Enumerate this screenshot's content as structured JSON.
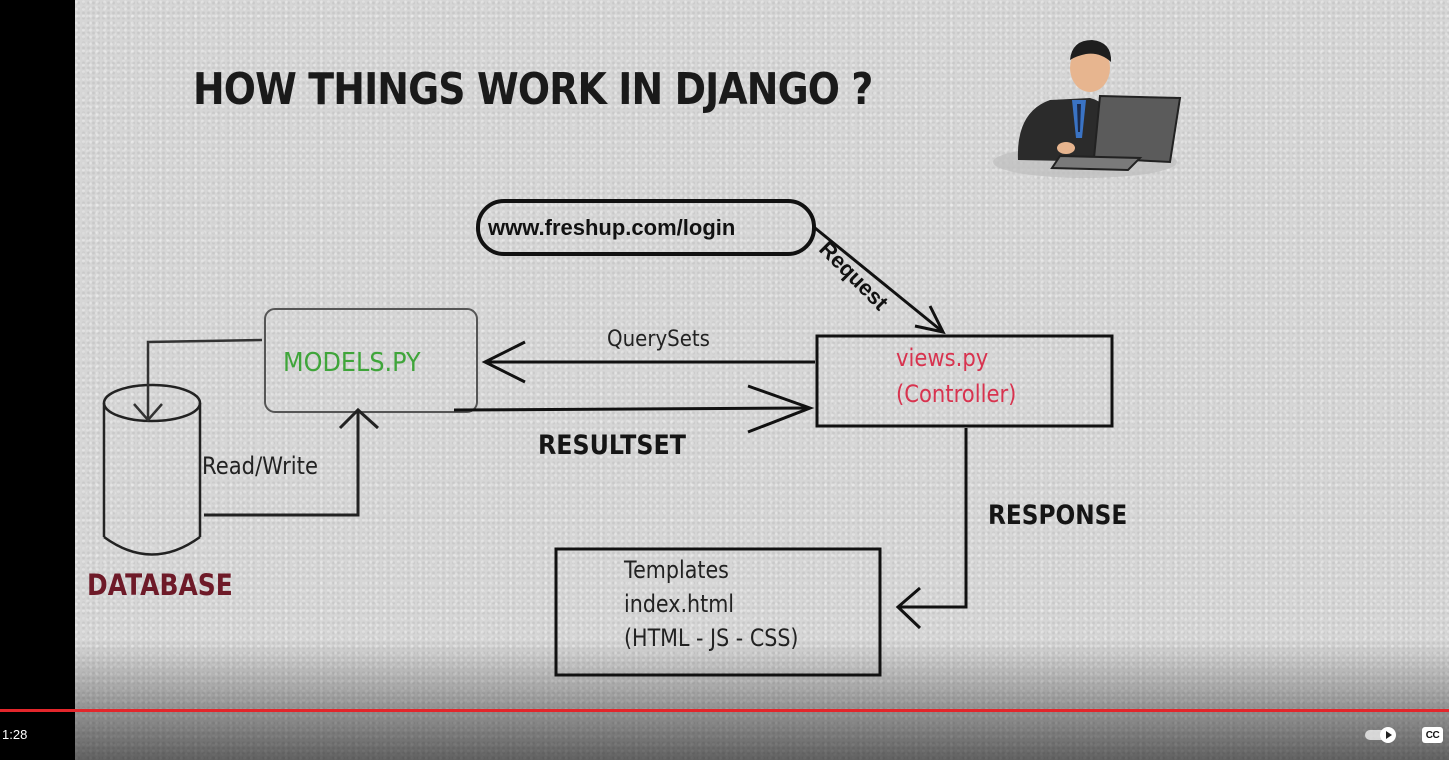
{
  "slide": {
    "title": "HOW THINGS WORK IN DJANGO ?",
    "url": "www.freshup.com/login",
    "request": "Request",
    "models": "MODELS.PY",
    "querysets": "QuerySets",
    "resultset": "RESULTSET",
    "views_line1": "views.py",
    "views_line2": "(Controller)",
    "read_write": "Read/Write",
    "response": "RESPONSE",
    "database": "DATABASE",
    "templates_line1": "Templates",
    "templates_line2": "index.html",
    "templates_line3": "(HTML - JS - CSS)"
  },
  "player": {
    "time": "1:28",
    "progress_fraction": 1.0,
    "autoplay_icon": "autoplay-toggle-icon",
    "cc_label": "CC",
    "progress_color": "#e3262b"
  },
  "colors": {
    "models": "#3fa53a",
    "views": "#d8334f",
    "database": "#6e1a28"
  }
}
